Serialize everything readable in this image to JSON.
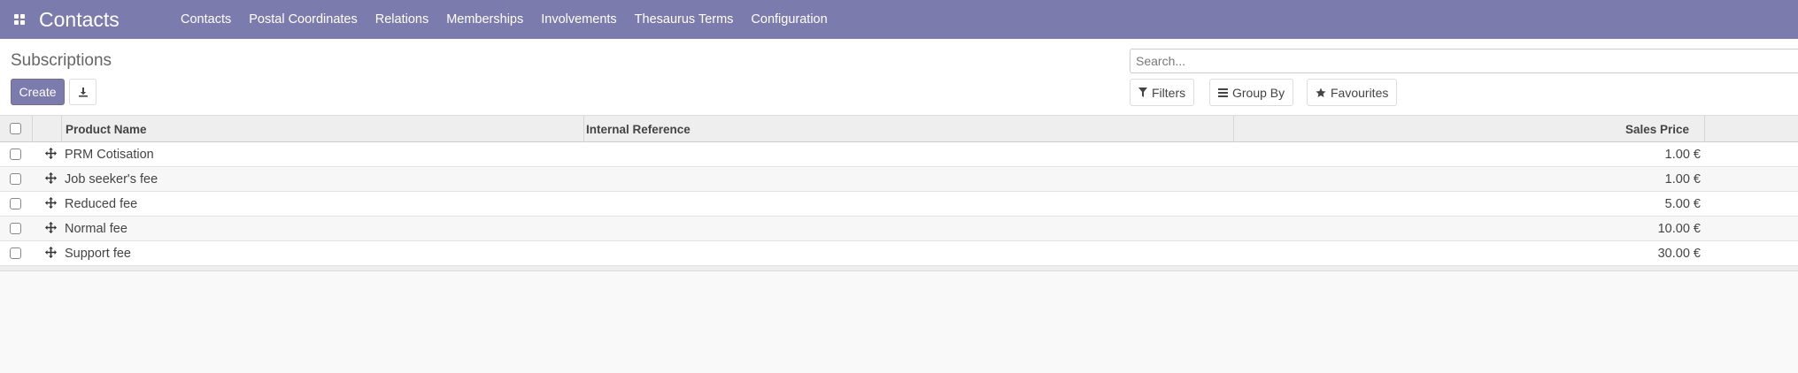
{
  "navbar": {
    "brand": "Contacts",
    "menu": [
      "Contacts",
      "Postal Coordinates",
      "Relations",
      "Memberships",
      "Involvements",
      "Thesaurus Terms",
      "Configuration"
    ]
  },
  "control_panel": {
    "breadcrumb": "Subscriptions",
    "create_label": "Create",
    "search_placeholder": "Search...",
    "filters_label": "Filters",
    "group_by_label": "Group By",
    "favourites_label": "Favourites"
  },
  "table": {
    "columns": {
      "product_name": "Product Name",
      "internal_reference": "Internal Reference",
      "sales_price": "Sales Price"
    },
    "rows": [
      {
        "name": "PRM Cotisation",
        "reference": "",
        "price": "1.00 €"
      },
      {
        "name": "Job seeker's fee",
        "reference": "",
        "price": "1.00 €"
      },
      {
        "name": "Reduced fee",
        "reference": "",
        "price": "5.00 €"
      },
      {
        "name": "Normal fee",
        "reference": "",
        "price": "10.00 €"
      },
      {
        "name": "Support fee",
        "reference": "",
        "price": "30.00 €"
      }
    ]
  },
  "colors": {
    "navbar": "#7c7bad",
    "primary_button": "#7c7bad"
  },
  "icons": {
    "apps": "grid-icon",
    "download": "download-icon",
    "filter": "filter-icon",
    "group_by": "bars-icon",
    "favourites": "star-icon",
    "row_handle": "drag-handle-icon"
  }
}
